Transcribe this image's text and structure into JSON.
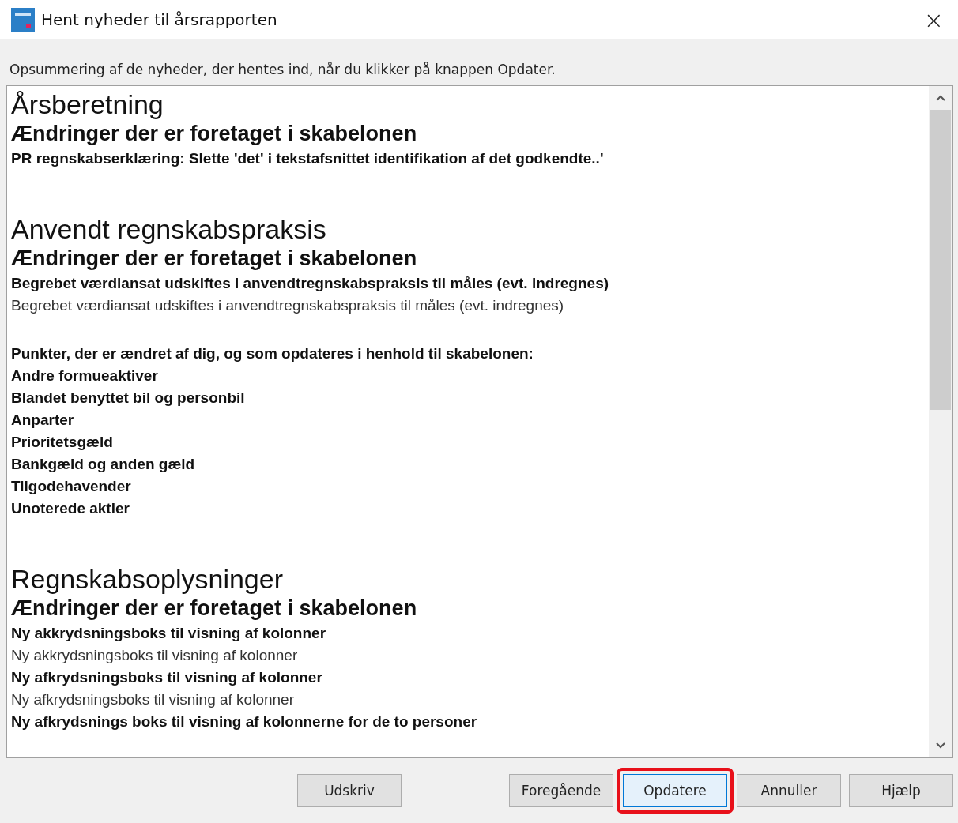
{
  "window": {
    "title": "Hent nyheder til årsrapporten",
    "close": "×"
  },
  "summary": "Opsummering af de nyheder, der hentes ind, når du klikker på knappen Opdater.",
  "sections": [
    {
      "title": "Årsberetning",
      "subtitle": "Ændringer der er foretaget i skabelonen",
      "lines": [
        {
          "kind": "bold",
          "text": "PR regnskabserklæring: Slette 'det' i tekstafsnittet identifikation af det godkendte..'"
        }
      ]
    },
    {
      "title": "Anvendt regnskabspraksis",
      "subtitle": "Ændringer der er foretaget i skabelonen",
      "lines": [
        {
          "kind": "bold",
          "text": "Begrebet værdiansat udskiftes i anvendtregnskabspraksis til måles (evt. indregnes)"
        },
        {
          "kind": "plain",
          "text": "Begrebet værdiansat udskiftes i anvendtregnskabspraksis til måles (evt. indregnes)"
        },
        {
          "kind": "gap"
        },
        {
          "kind": "bold",
          "text": "Punkter, der er ændret af dig, og som opdateres i henhold til skabelonen:"
        },
        {
          "kind": "bold",
          "text": "Andre formueaktiver"
        },
        {
          "kind": "bold",
          "text": "Blandet benyttet bil og personbil"
        },
        {
          "kind": "bold",
          "text": "Anparter"
        },
        {
          "kind": "bold",
          "text": "Prioritetsgæld"
        },
        {
          "kind": "bold",
          "text": "Bankgæld og anden gæld"
        },
        {
          "kind": "bold",
          "text": "Tilgodehavender"
        },
        {
          "kind": "bold",
          "text": "Unoterede aktier"
        }
      ]
    },
    {
      "title": "Regnskabsoplysninger",
      "subtitle": "Ændringer der er foretaget i skabelonen",
      "lines": [
        {
          "kind": "bold",
          "text": "Ny akkrydsningsboks til visning af kolonner"
        },
        {
          "kind": "plain",
          "text": "Ny akkrydsningsboks til visning af kolonner"
        },
        {
          "kind": "bold",
          "text": "Ny afkrydsningsboks til visning af kolonner"
        },
        {
          "kind": "plain",
          "text": "Ny afkrydsningsboks til visning af kolonner"
        },
        {
          "kind": "bold",
          "text": "Ny afkrydsnings boks til visning af kolonnerne for de to personer"
        }
      ]
    }
  ],
  "buttons": [
    {
      "label": "Udskriv",
      "highlighted": false,
      "default": false
    },
    {
      "label": "Foregående",
      "highlighted": false,
      "default": false
    },
    {
      "label": "Opdatere",
      "highlighted": true,
      "default": true
    },
    {
      "label": "Annuller",
      "highlighted": false,
      "default": false
    },
    {
      "label": "Hjælp",
      "highlighted": false,
      "default": false
    }
  ]
}
